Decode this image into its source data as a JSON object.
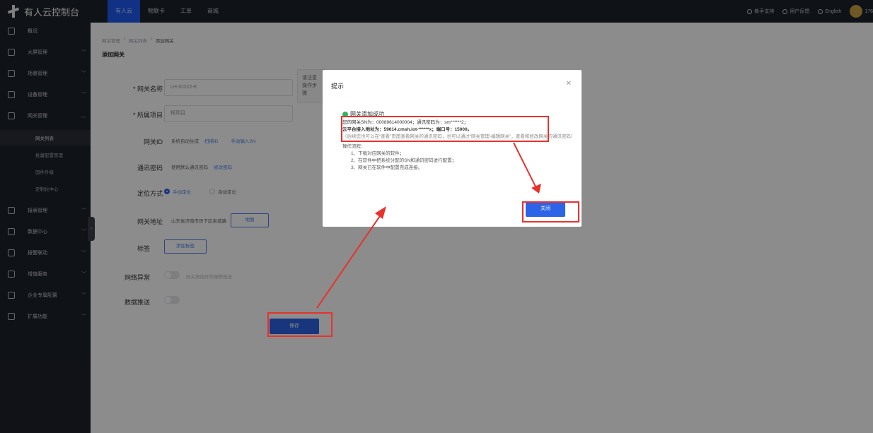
{
  "app": {
    "title": "有人云控制台"
  },
  "topnav": [
    {
      "label": "有人云",
      "active": true
    },
    {
      "label": "物联卡",
      "active": false
    },
    {
      "label": "工单",
      "active": false
    },
    {
      "label": "商城",
      "active": false
    }
  ],
  "topright": {
    "support": "新手支持",
    "feedback": "用户反馈",
    "language": "English",
    "user": "176"
  },
  "sidebar": {
    "items": [
      {
        "label": "概况",
        "icon": "dashboard-icon"
      },
      {
        "label": "大屏管理",
        "icon": "screen-icon"
      },
      {
        "label": "场景管理",
        "icon": "scene-icon"
      },
      {
        "label": "设备管理",
        "icon": "device-icon"
      },
      {
        "label": "网关管理",
        "icon": "gateway-icon"
      },
      {
        "label": "报表管理",
        "icon": "report-icon"
      },
      {
        "label": "数据中心",
        "icon": "data-icon"
      },
      {
        "label": "报警联动",
        "icon": "alarm-icon"
      },
      {
        "label": "增值服务",
        "icon": "service-icon"
      },
      {
        "label": "企业专属配置",
        "icon": "config-icon"
      },
      {
        "label": "扩展功能",
        "icon": "extend-icon"
      }
    ],
    "sub_items": [
      {
        "label": "网关列表",
        "active": true
      },
      {
        "label": "批量配置管理",
        "active": false
      },
      {
        "label": "固件升级",
        "active": false
      },
      {
        "label": "定制化中心",
        "active": false
      }
    ]
  },
  "breadcrumb": [
    "网关管理",
    "网关列表",
    "添加网关"
  ],
  "page_title": "添加网关",
  "form": {
    "name_label": "* 网关名称",
    "name_value": "LH-IO222-E",
    "project_label": "* 所属项目",
    "project_value": "根项目",
    "id_label": "网关ID",
    "id_value": "系统自动生成",
    "id_scan": "扫描ID",
    "id_manual": "手动输入SN",
    "pwd_label": "通讯密码",
    "pwd_value": "使用默认通讯密码",
    "pwd_edit": "修改密码",
    "loc_label": "定位方式",
    "loc_manual": "手动定位",
    "loc_auto": "自动定位",
    "addr_label": "网关地址",
    "addr_value": "山东省济南市历下区泉城路",
    "addr_btn": "地图",
    "tag_label": "标签",
    "tag_btn": "添加标签",
    "offline_label": "网络异常",
    "offline_hint": "网关离线异常报警推送",
    "push_label": "数据推送",
    "save_label": "保存",
    "hint_text": "请注意操作步骤"
  },
  "modal": {
    "title": "提示",
    "success": "网关添加成功",
    "sn_line": "您的网关SN为：00089614000004；通讯密码为：sm******2；",
    "server_line": "云平台接入地址为：59614.cmsh.iot-******x；端口号：15000。",
    "note": "（后续您也可以在“查看”页面查看网关的通讯密码，也可以通过“网关管理-编辑网关”，查看和修改网关的通讯密码）",
    "steps_title": "操作流程：",
    "steps": [
      "1、下载对应网关的软件；",
      "2、在软件中把系统分配的SN和通讯密码进行配置；",
      "3、网关已在软件中配置完成连接。"
    ],
    "confirm": "关闭"
  },
  "colors": {
    "accent": "#2d63e6",
    "annotation": "#e8322d",
    "success": "#33b35f"
  }
}
